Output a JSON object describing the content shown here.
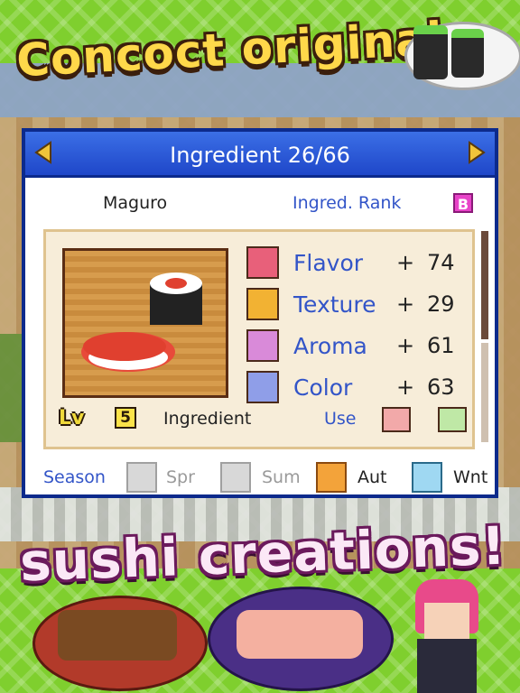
{
  "headline_top": "Concoct original",
  "headline_bottom": "sushi creations!",
  "panel": {
    "title": "Ingredient 26/66",
    "ingredient_name": "Maguro",
    "rank_label": "Ingred. Rank",
    "rank_value": "B",
    "stats": [
      {
        "label": "Flavor",
        "sign": "+",
        "value": "74",
        "color": "#e8607a",
        "icon": "lips-icon"
      },
      {
        "label": "Texture",
        "sign": "+",
        "value": "29",
        "color": "#f2b233",
        "icon": "texture-icon"
      },
      {
        "label": "Aroma",
        "sign": "+",
        "value": "61",
        "color": "#d98ad9",
        "icon": "aroma-icon"
      },
      {
        "label": "Color",
        "sign": "+",
        "value": "63",
        "color": "#8f9ee8",
        "icon": "sparkle-icon"
      }
    ],
    "level_label": "Lv",
    "level_value": "5",
    "category": "Ingredient",
    "use_label": "Use",
    "season_label": "Season",
    "seasons": [
      {
        "name": "Spr",
        "active": false
      },
      {
        "name": "Sum",
        "active": false
      },
      {
        "name": "Aut",
        "active": true
      },
      {
        "name": "Wnt",
        "active": true
      }
    ]
  }
}
